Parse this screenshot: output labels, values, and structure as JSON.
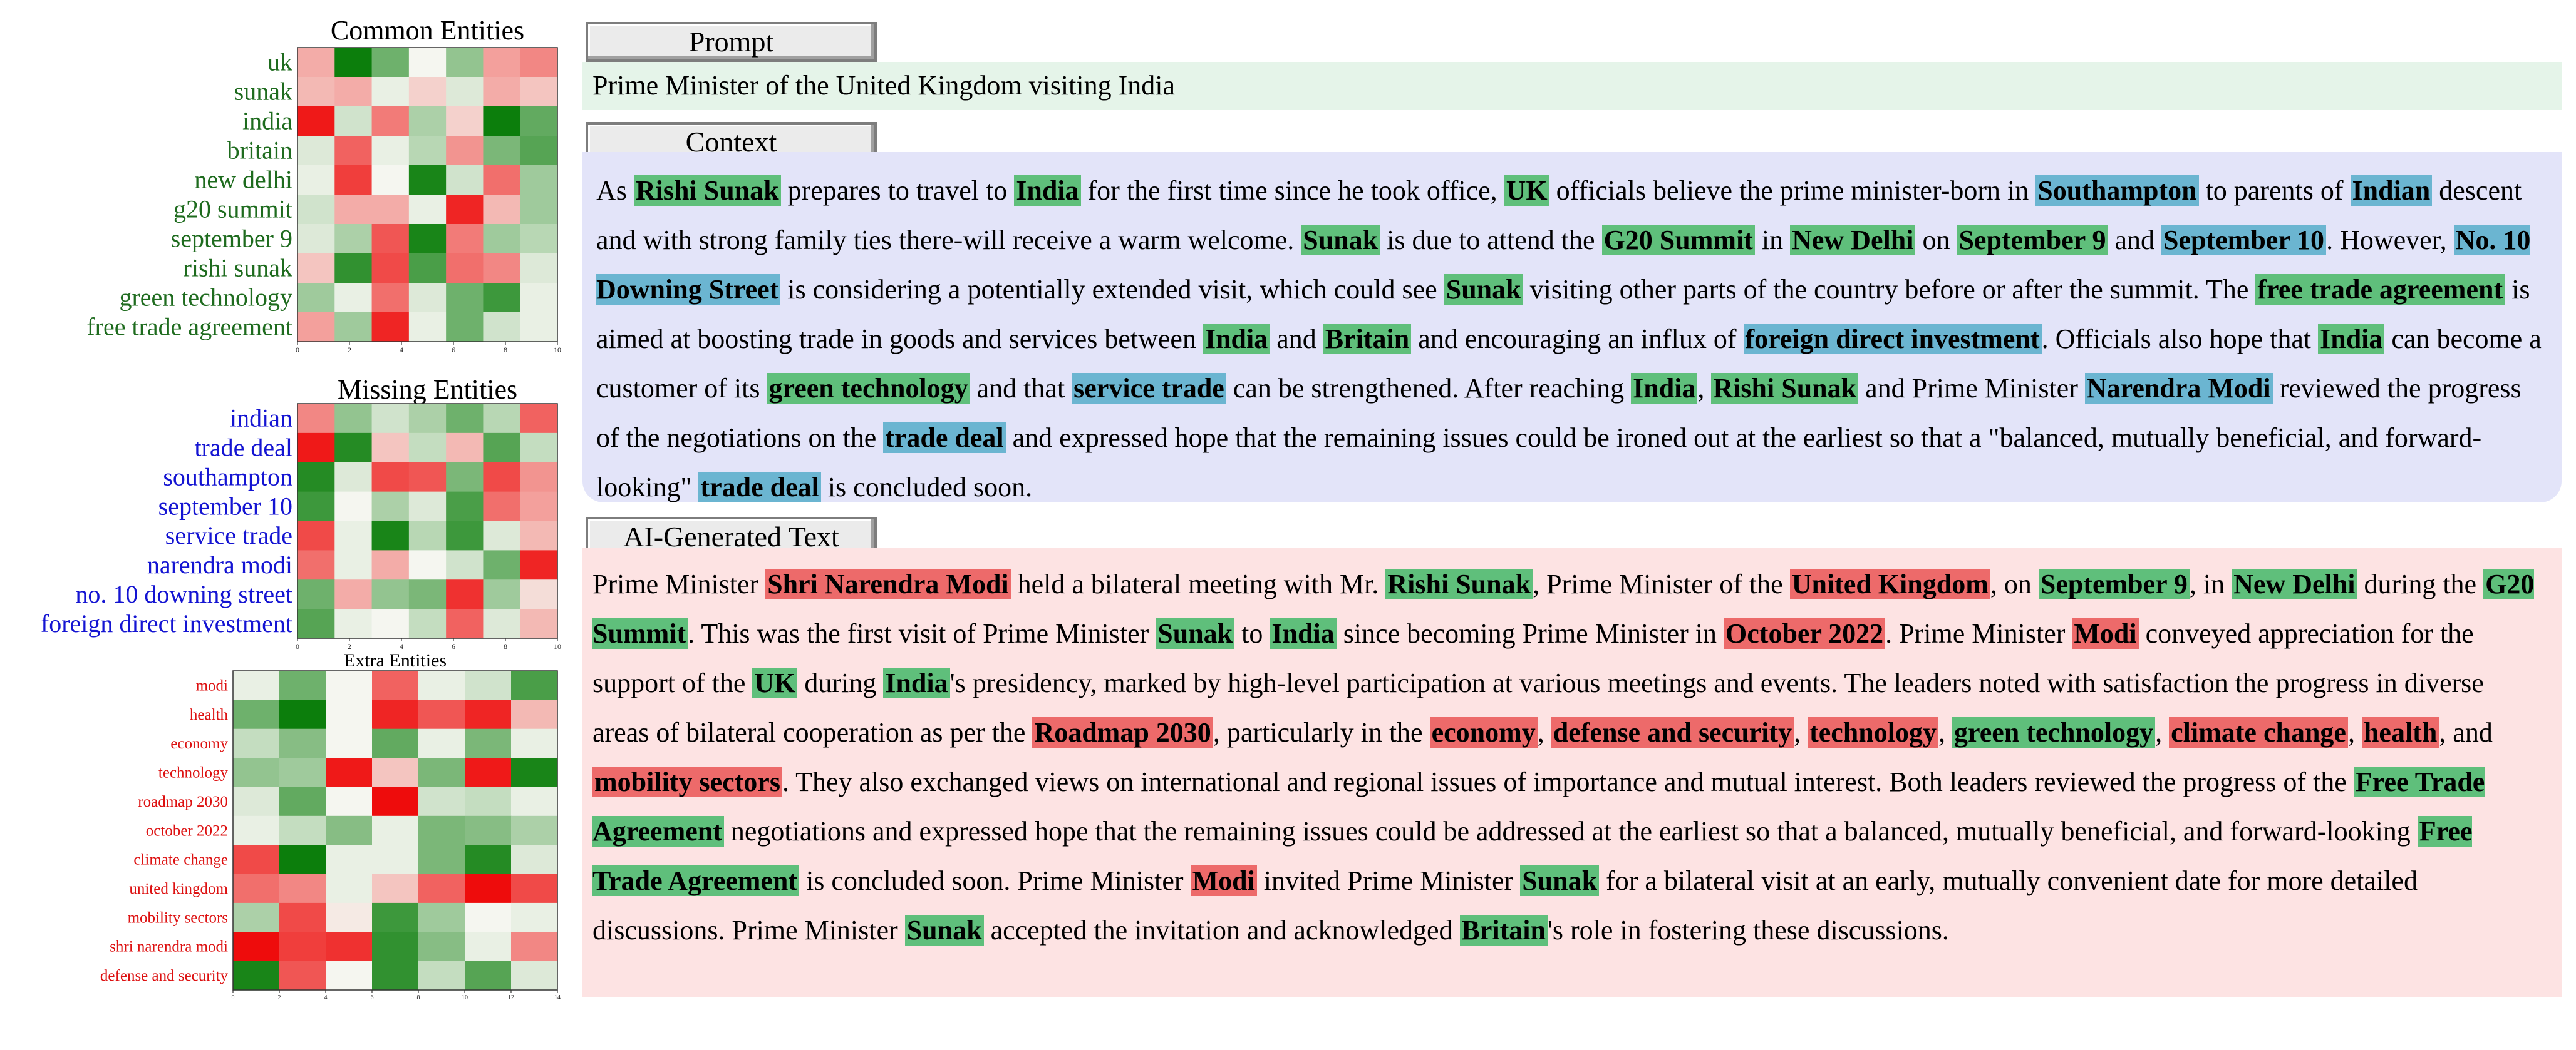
{
  "colors": {
    "common_entity": "#1e6b1e",
    "missing_entity": "#1414d2",
    "extra_entity": "#dd1111",
    "highlight_common": "#5fbf7b",
    "highlight_missing": "#6bb5d1",
    "highlight_extra": "#ed6a6a",
    "prompt_bg": "#e5f4e9",
    "context_bg": "#e3e4f9",
    "generated_bg": "#fde3e3"
  },
  "chart_data": [
    {
      "type": "heatmap",
      "title": "Common Entities",
      "rows": [
        "uk",
        "sunak",
        "india",
        "britain",
        "new delhi",
        "g20 summit",
        "september 9",
        "rishi sunak",
        "green technology",
        "free trade agreement"
      ],
      "x_ticks": [
        "0",
        "2",
        "4",
        "6",
        "8",
        "10"
      ],
      "colormap": "red-white-green (diverging)",
      "values": [
        [
          -0.3,
          0.95,
          0.55,
          0.0,
          0.4,
          -0.35,
          -0.45
        ],
        [
          -0.25,
          -0.3,
          0.05,
          -0.15,
          0.1,
          -0.3,
          -0.2
        ],
        [
          -0.9,
          0.15,
          -0.5,
          0.3,
          -0.15,
          0.95,
          0.6
        ],
        [
          0.1,
          -0.6,
          0.05,
          0.25,
          -0.4,
          0.5,
          0.65
        ],
        [
          0.05,
          -0.75,
          0.0,
          0.9,
          0.15,
          -0.55,
          0.35
        ],
        [
          0.15,
          -0.3,
          -0.3,
          0.05,
          -0.85,
          -0.25,
          0.35
        ],
        [
          0.1,
          0.3,
          -0.65,
          0.9,
          -0.5,
          0.35,
          0.25
        ],
        [
          -0.2,
          0.8,
          -0.7,
          0.7,
          -0.55,
          -0.45,
          0.1
        ],
        [
          0.35,
          0.05,
          -0.55,
          0.1,
          0.55,
          0.75,
          0.05
        ],
        [
          -0.35,
          0.35,
          -0.85,
          0.05,
          0.55,
          0.15,
          0.05
        ]
      ]
    },
    {
      "type": "heatmap",
      "title": "Missing Entities",
      "rows": [
        "indian",
        "trade deal",
        "southampton",
        "september 10",
        "service trade",
        "narendra modi",
        "no. 10 downing street",
        "foreign direct investment"
      ],
      "x_ticks": [
        "0",
        "2",
        "4",
        "6",
        "8",
        "10"
      ],
      "colormap": "red-white-green (diverging)",
      "values": [
        [
          -0.45,
          0.4,
          0.15,
          0.3,
          0.55,
          0.25,
          -0.6
        ],
        [
          -0.9,
          0.85,
          -0.2,
          0.2,
          -0.25,
          0.65,
          0.2
        ],
        [
          0.85,
          0.1,
          -0.7,
          -0.65,
          0.5,
          -0.7,
          -0.4
        ],
        [
          0.75,
          0.0,
          0.3,
          0.1,
          0.7,
          -0.55,
          -0.35
        ],
        [
          -0.7,
          0.05,
          0.9,
          0.25,
          0.75,
          0.1,
          -0.25
        ],
        [
          -0.55,
          0.05,
          -0.3,
          0.0,
          0.15,
          0.55,
          -0.85
        ],
        [
          0.55,
          -0.3,
          0.4,
          0.5,
          -0.8,
          0.35,
          -0.1
        ],
        [
          0.65,
          0.05,
          0.0,
          0.2,
          -0.6,
          0.1,
          -0.25
        ]
      ]
    },
    {
      "type": "heatmap",
      "title": "Extra Entities",
      "rows": [
        "modi",
        "health",
        "economy",
        "technology",
        "roadmap 2030",
        "october 2022",
        "climate change",
        "united kingdom",
        "mobility sectors",
        "shri narendra modi",
        "defense and security"
      ],
      "x_ticks": [
        "0",
        "2",
        "4",
        "6",
        "8",
        "10",
        "12",
        "14"
      ],
      "colormap": "red-white-green (diverging)",
      "values": [
        [
          0.05,
          0.55,
          0.0,
          -0.6,
          0.05,
          0.15,
          0.7
        ],
        [
          0.55,
          0.95,
          0.0,
          -0.85,
          -0.65,
          -0.85,
          -0.25
        ],
        [
          0.2,
          0.45,
          0.0,
          0.6,
          0.05,
          0.5,
          0.05
        ],
        [
          0.4,
          0.35,
          -0.9,
          -0.2,
          0.5,
          -0.9,
          0.9
        ],
        [
          0.1,
          0.6,
          0.0,
          -0.95,
          0.15,
          0.2,
          0.05
        ],
        [
          0.05,
          0.2,
          0.45,
          0.05,
          0.5,
          0.45,
          0.3
        ],
        [
          -0.7,
          0.95,
          0.05,
          0.05,
          0.5,
          0.85,
          0.1
        ],
        [
          -0.55,
          -0.45,
          0.05,
          -0.2,
          -0.6,
          -0.95,
          -0.7
        ],
        [
          0.3,
          -0.7,
          -0.05,
          0.75,
          0.35,
          0.0,
          0.05
        ],
        [
          -0.95,
          -0.75,
          -0.8,
          0.8,
          0.45,
          0.05,
          -0.45
        ],
        [
          0.9,
          -0.65,
          0.0,
          0.8,
          0.2,
          0.65,
          0.1
        ]
      ]
    }
  ],
  "prompt": {
    "label": "Prompt",
    "text": "Prime Minister of the United Kingdom visiting India"
  },
  "context": {
    "label": "Context",
    "segments": [
      {
        "t": "As ",
        "k": ""
      },
      {
        "t": "Rishi Sunak",
        "k": "c"
      },
      {
        "t": " prepares to travel to ",
        "k": ""
      },
      {
        "t": "India",
        "k": "c"
      },
      {
        "t": " for the first time since he took office, ",
        "k": ""
      },
      {
        "t": "UK",
        "k": "c"
      },
      {
        "t": " officials believe the prime minister-born in ",
        "k": ""
      },
      {
        "t": "Southampton",
        "k": "m"
      },
      {
        "t": " to parents of ",
        "k": ""
      },
      {
        "t": "Indian",
        "k": "m"
      },
      {
        "t": " descent and with strong family ties there-will receive a warm welcome. ",
        "k": ""
      },
      {
        "t": "Sunak",
        "k": "c"
      },
      {
        "t": " is due to attend the ",
        "k": ""
      },
      {
        "t": "G20 Summit",
        "k": "c"
      },
      {
        "t": " in ",
        "k": ""
      },
      {
        "t": "New Delhi",
        "k": "c"
      },
      {
        "t": " on ",
        "k": ""
      },
      {
        "t": "September 9",
        "k": "c"
      },
      {
        "t": " and ",
        "k": ""
      },
      {
        "t": "September 10",
        "k": "m"
      },
      {
        "t": ". However, ",
        "k": ""
      },
      {
        "t": "No. 10 Downing Street",
        "k": "m"
      },
      {
        "t": " is considering a potentially extended visit, which could see ",
        "k": ""
      },
      {
        "t": "Sunak",
        "k": "c"
      },
      {
        "t": " visiting other parts of the country before or after the summit. The ",
        "k": ""
      },
      {
        "t": "free trade agreement",
        "k": "c"
      },
      {
        "t": " is aimed at boosting trade in goods and services between ",
        "k": ""
      },
      {
        "t": "India",
        "k": "c"
      },
      {
        "t": " and ",
        "k": ""
      },
      {
        "t": "Britain",
        "k": "c"
      },
      {
        "t": " and encouraging an influx of ",
        "k": ""
      },
      {
        "t": "foreign direct investment",
        "k": "m"
      },
      {
        "t": ". Officials also hope that ",
        "k": ""
      },
      {
        "t": "India",
        "k": "c"
      },
      {
        "t": " can become a customer of its ",
        "k": ""
      },
      {
        "t": "green technology",
        "k": "c"
      },
      {
        "t": " and that ",
        "k": ""
      },
      {
        "t": "service trade",
        "k": "m"
      },
      {
        "t": " can be strengthened. After reaching ",
        "k": ""
      },
      {
        "t": "India",
        "k": "c"
      },
      {
        "t": ", ",
        "k": ""
      },
      {
        "t": "Rishi Sunak",
        "k": "c"
      },
      {
        "t": " and Prime Minister ",
        "k": ""
      },
      {
        "t": "Narendra Modi",
        "k": "m"
      },
      {
        "t": " reviewed the progress of the negotiations on the ",
        "k": ""
      },
      {
        "t": "trade deal",
        "k": "m"
      },
      {
        "t": " and expressed hope that the remaining issues could be ironed out at the earliest so that a \"balanced, mutually beneficial, and forward-looking\" ",
        "k": ""
      },
      {
        "t": "trade deal",
        "k": "m"
      },
      {
        "t": " is concluded soon.",
        "k": ""
      }
    ]
  },
  "generated": {
    "label": "AI-Generated Text",
    "segments": [
      {
        "t": "Prime Minister ",
        "k": ""
      },
      {
        "t": "Shri Narendra Modi",
        "k": "e"
      },
      {
        "t": " held a bilateral meeting with Mr. ",
        "k": ""
      },
      {
        "t": "Rishi Sunak",
        "k": "c"
      },
      {
        "t": ", Prime Minister of the ",
        "k": ""
      },
      {
        "t": "United Kingdom",
        "k": "e"
      },
      {
        "t": ", on ",
        "k": ""
      },
      {
        "t": "September 9",
        "k": "c"
      },
      {
        "t": ", in ",
        "k": ""
      },
      {
        "t": "New Delhi",
        "k": "c"
      },
      {
        "t": " during the ",
        "k": ""
      },
      {
        "t": "G20 Summit",
        "k": "c"
      },
      {
        "t": ". This was the first visit of Prime Minister ",
        "k": ""
      },
      {
        "t": "Sunak",
        "k": "c"
      },
      {
        "t": " to ",
        "k": ""
      },
      {
        "t": "India",
        "k": "c"
      },
      {
        "t": " since becoming Prime Minister in ",
        "k": ""
      },
      {
        "t": "October 2022",
        "k": "e"
      },
      {
        "t": ". Prime Minister ",
        "k": ""
      },
      {
        "t": "Modi",
        "k": "e"
      },
      {
        "t": " conveyed appreciation for the support of the ",
        "k": ""
      },
      {
        "t": "UK",
        "k": "c"
      },
      {
        "t": " during ",
        "k": ""
      },
      {
        "t": "India",
        "k": "c"
      },
      {
        "t": "'s presidency, marked by high-level participation at various meetings and events. The leaders noted with satisfaction the progress in diverse areas of bilateral cooperation as per the ",
        "k": ""
      },
      {
        "t": "Roadmap 2030",
        "k": "e"
      },
      {
        "t": ", particularly in the ",
        "k": ""
      },
      {
        "t": "economy",
        "k": "e"
      },
      {
        "t": ", ",
        "k": ""
      },
      {
        "t": "defense and security",
        "k": "e"
      },
      {
        "t": ", ",
        "k": ""
      },
      {
        "t": "technology",
        "k": "e"
      },
      {
        "t": ", ",
        "k": ""
      },
      {
        "t": "green technology",
        "k": "c"
      },
      {
        "t": ", ",
        "k": ""
      },
      {
        "t": "climate change",
        "k": "e"
      },
      {
        "t": ", ",
        "k": ""
      },
      {
        "t": "health",
        "k": "e"
      },
      {
        "t": ", and ",
        "k": ""
      },
      {
        "t": "mobility sectors",
        "k": "e"
      },
      {
        "t": ". They also exchanged views on international and regional issues of importance and mutual interest. Both leaders reviewed the progress of the ",
        "k": ""
      },
      {
        "t": "Free Trade Agreement",
        "k": "c"
      },
      {
        "t": " negotiations and expressed hope that the remaining issues could be addressed at the earliest so that a balanced, mutually beneficial, and forward-looking ",
        "k": ""
      },
      {
        "t": "Free Trade Agreement",
        "k": "c"
      },
      {
        "t": " is concluded soon. Prime Minister ",
        "k": ""
      },
      {
        "t": "Modi",
        "k": "e"
      },
      {
        "t": " invited Prime Minister ",
        "k": ""
      },
      {
        "t": "Sunak",
        "k": "c"
      },
      {
        "t": " for a bilateral visit at an early, mutually convenient date for more detailed discussions. Prime Minister ",
        "k": ""
      },
      {
        "t": "Sunak",
        "k": "c"
      },
      {
        "t": " accepted the invitation and acknowledged ",
        "k": ""
      },
      {
        "t": "Britain",
        "k": "c"
      },
      {
        "t": "'s role in fostering these discussions.",
        "k": ""
      }
    ]
  }
}
